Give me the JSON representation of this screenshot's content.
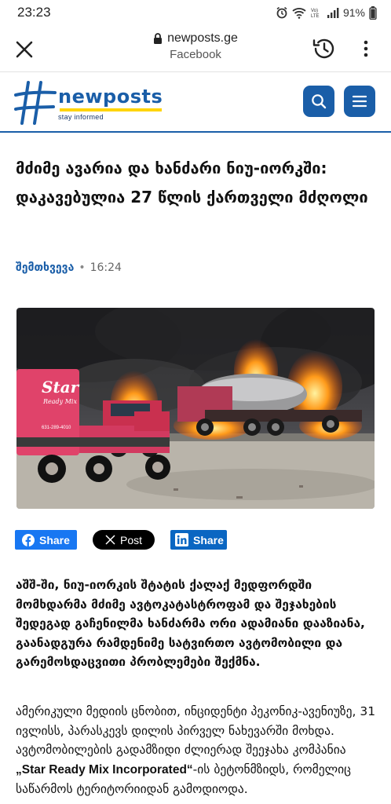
{
  "status_bar": {
    "time": "23:23",
    "battery": "91%"
  },
  "browser": {
    "domain": "newposts.ge",
    "source": "Facebook"
  },
  "site": {
    "logo_text": "newposts",
    "tagline": "stay informed"
  },
  "article": {
    "title": "მძიმე ავარია და ხანძარი ნიუ-იორკში: დაკავებულია 27 წლის ქართველი მძღოლი",
    "category": "შემთხვევა",
    "time": "16:24",
    "share": {
      "facebook": "Share",
      "x": "Post",
      "linkedin": "Share"
    },
    "lead": "აშშ-ში, ნიუ-იორკის შტატის ქალაქ მედფორდში მომხდარმა მძიმე ავტოკატასტროფამ და შეჯახების შედეგად გაჩენილმა ხანძარმა ორი ადამიანი დააზიანა, გაანადგურა რამდენიმე სატვირთო ავტომობილი და გარემოსდაცვითი პრობლემები შექმნა.",
    "body_before": "ამერიკული მედიის ცნობით, ინციდენტი პეკონიკ-ავენიუზე, 31 ივლისს, პარასკევს დილის პირველ ნახევარში მოხდა. ავტომობილების გადამზიდი ძლიერად შეეჯახა კომპანია ",
    "body_company": "„Star Ready Mix Incorporated“",
    "body_after": "-ის ბეტონმზიდს, რომელიც საწარმოს ტერიტორიიდან გამოდიოდა."
  },
  "hero_image": {
    "truck_text": "Star",
    "truck_sub": "Ready Mix",
    "phone": "631-289-4010"
  },
  "colors": {
    "brand": "#1a5ea8",
    "facebook": "#1877f2",
    "x": "#000000",
    "linkedin": "#0a66c2"
  }
}
